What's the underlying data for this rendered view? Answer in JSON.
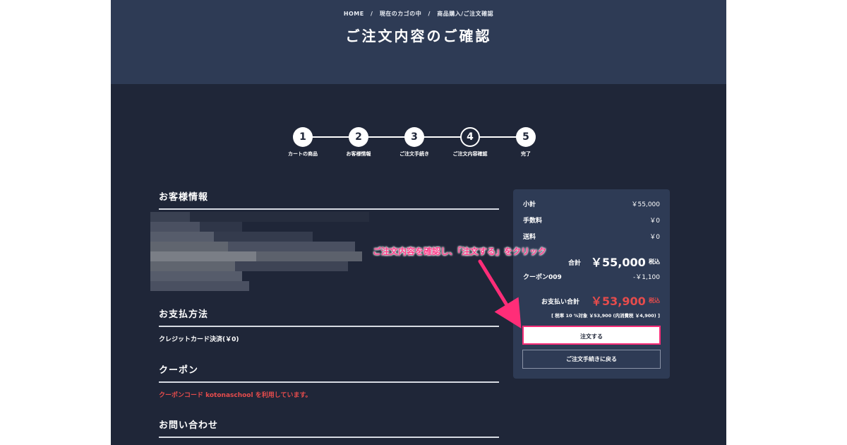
{
  "breadcrumb": {
    "home": "HOME",
    "cart": "現在のカゴの中",
    "purchase": "商品購入/ご注文確認",
    "separator": "/"
  },
  "page_title": "ご注文内容のご確認",
  "steps": [
    {
      "number": "1",
      "label": "カートの商品"
    },
    {
      "number": "2",
      "label": "お客様情報"
    },
    {
      "number": "3",
      "label": "ご注文手続き"
    },
    {
      "number": "4",
      "label": "ご注文内容確認"
    },
    {
      "number": "5",
      "label": "完了"
    }
  ],
  "current_step": 4,
  "sections": {
    "customer_info": {
      "heading": "お客様情報"
    },
    "payment": {
      "heading": "お支払方法",
      "value": "クレジットカード決済(￥0)"
    },
    "coupon": {
      "heading": "クーポン",
      "value": "クーポンコード kotonaschool を利用しています。"
    },
    "contact": {
      "heading": "お問い合わせ"
    }
  },
  "summary": {
    "subtotal_label": "小計",
    "subtotal_value": "￥55,000",
    "fee_label": "手数料",
    "fee_value": "￥0",
    "shipping_label": "送料",
    "shipping_value": "￥0",
    "total_label": "合計",
    "total_value": "￥55,000",
    "total_tax": "税込",
    "coupon_label": "クーポン009",
    "coupon_value": "-￥1,100",
    "pay_label": "お支払い合計",
    "pay_value": "￥53,900",
    "pay_tax": "税込",
    "tax_note": "[ 税率 10 %対象 ￥53,900 (内消費税 ￥4,900) ]",
    "order_button": "注文する",
    "back_button": "ご注文手続きに戻る"
  },
  "annotation": {
    "text": "ご注文内容を確認し、「注文する」をクリック"
  },
  "colors": {
    "page_bg": "#1f2638",
    "hero_bg": "#2e3b55",
    "accent_red": "#e64c4c",
    "annotation_pink": "#ff2d78"
  }
}
